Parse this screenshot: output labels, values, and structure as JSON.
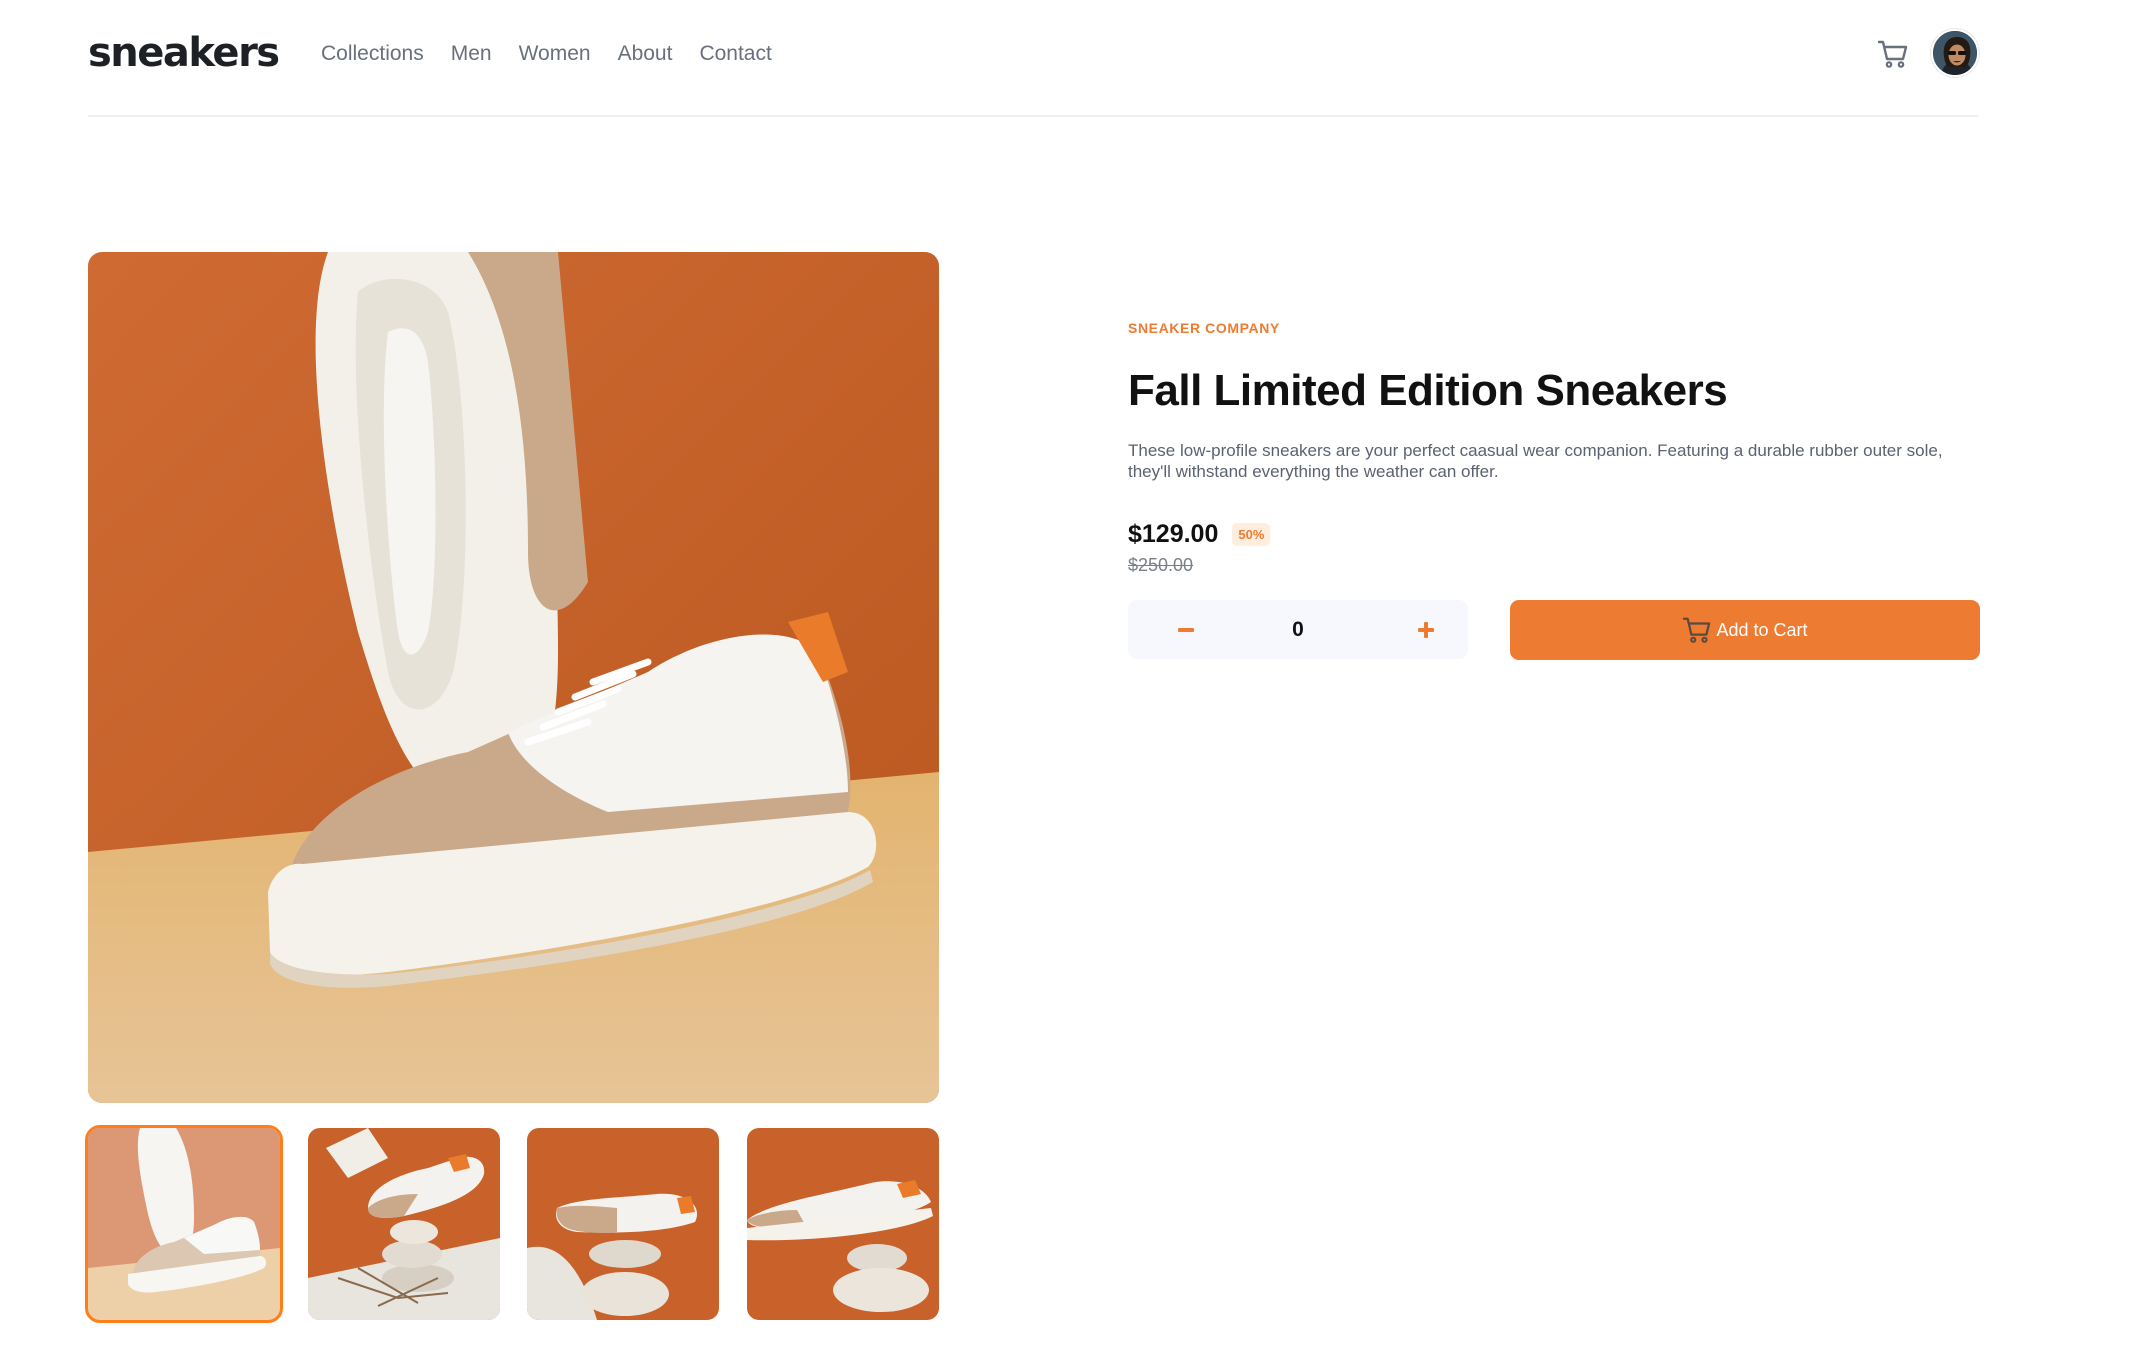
{
  "header": {
    "logo": "sneakers",
    "nav": [
      "Collections",
      "Men",
      "Women",
      "About",
      "Contact"
    ],
    "cart_icon": "cart-icon",
    "avatar_icon": "user-avatar"
  },
  "product": {
    "company": "SNEAKER COMPANY",
    "title": "Fall Limited Edition Sneakers",
    "description": "These low-profile sneakers are your perfect caasual wear companion. Featuring a durable rubber outer sole, they'll withstand everything the weather can offer.",
    "price": "$129.00",
    "discount": "50%",
    "old_price": "$250.00"
  },
  "cart_controls": {
    "quantity": "0",
    "add_label": "Add to Cart",
    "minus_icon": "minus-icon",
    "plus_icon": "plus-icon"
  },
  "gallery": {
    "thumbnails": 4,
    "active_index": 0
  },
  "colors": {
    "accent": "#ee7b32",
    "accent_pale": "#ffeede",
    "text_dark": "#111111",
    "text_muted": "#69707d",
    "qty_bg": "#f6f8fd"
  }
}
